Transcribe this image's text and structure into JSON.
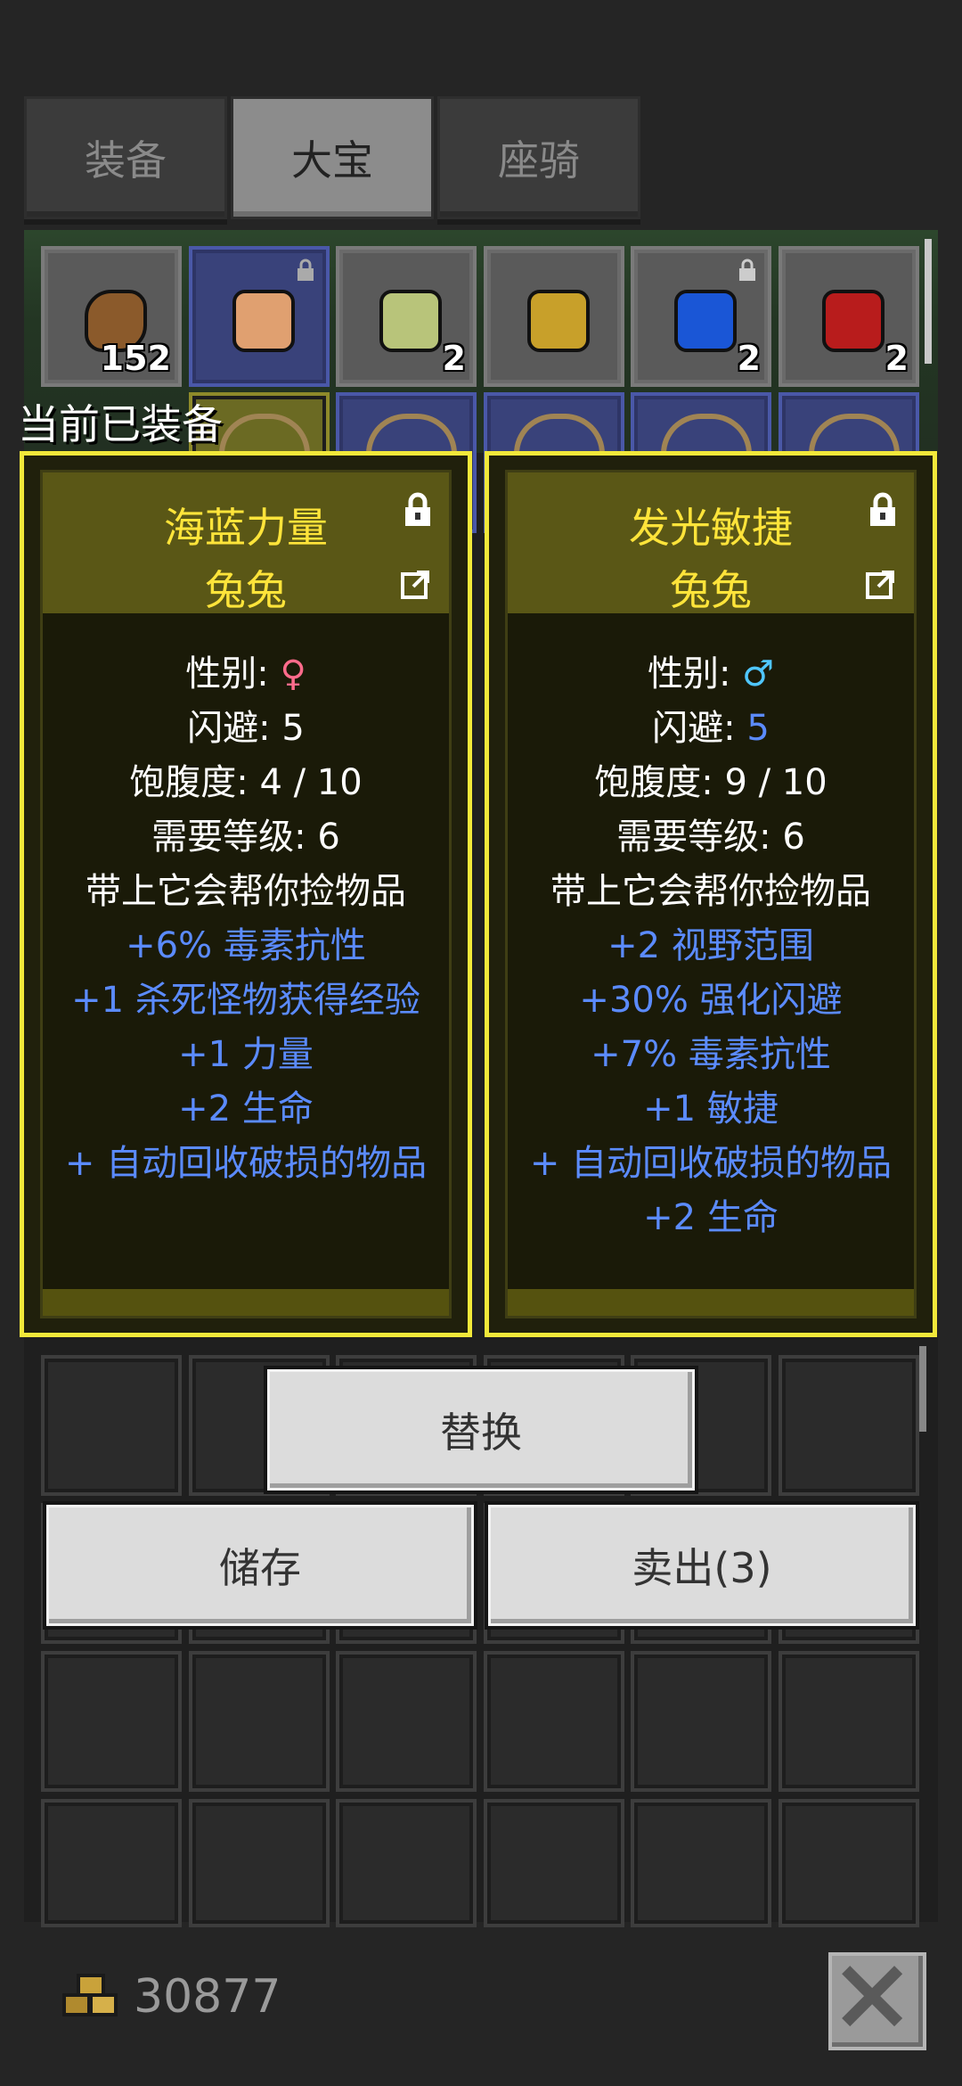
{
  "tabs": [
    {
      "label": "装备",
      "active": false
    },
    {
      "label": "大宝",
      "active": true
    },
    {
      "label": "座骑",
      "active": false
    }
  ],
  "inventory": {
    "row1_quantities": [
      "152",
      "",
      "2",
      "",
      "2",
      "2"
    ],
    "equipped_label": "当前已装备"
  },
  "cards": [
    {
      "title": "海蓝力量",
      "subtitle": "兔兔",
      "gender_label": "性别: ",
      "gender_symbol": "♀",
      "dodge_label": "闪避: ",
      "dodge_value": "5",
      "satiety": "饱腹度: 4 / 10",
      "level": "需要等级: 6",
      "desc": "带上它会帮你捡物品",
      "bonuses": [
        "+6% 毒素抗性",
        "+1 杀死怪物获得经验",
        "+1 力量",
        "+2 生命",
        "+ 自动回收破损的物品"
      ]
    },
    {
      "title": "发光敏捷",
      "subtitle": "兔兔",
      "gender_label": "性别: ",
      "gender_symbol": "♂",
      "dodge_label": "闪避: ",
      "dodge_value": "5",
      "satiety": "饱腹度: 9 / 10",
      "level": "需要等级: 6",
      "desc": "带上它会帮你捡物品",
      "bonuses": [
        "+2 视野范围",
        "+30% 强化闪避",
        "+7% 毒素抗性",
        "+1 敏捷",
        "+ 自动回收破损的物品",
        "+2 生命"
      ]
    }
  ],
  "buttons": {
    "replace": "替换",
    "store": "储存",
    "sell": "卖出(3)"
  },
  "gold": "30877",
  "colors": {
    "card_border": "#f2e83a",
    "title_yellow": "#ffe43a",
    "bonus_blue": "#5b8bff",
    "female": "#ff6b8b",
    "male": "#4fc6ff"
  }
}
